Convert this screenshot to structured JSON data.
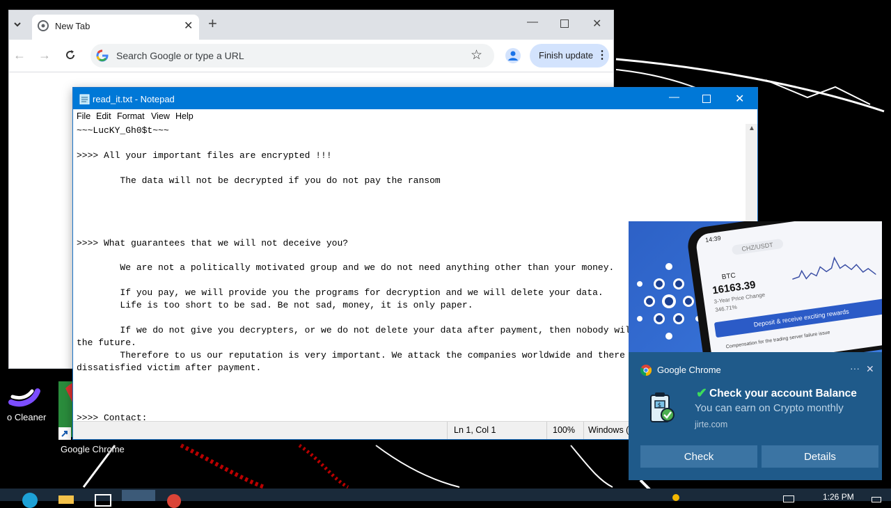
{
  "desktop": {
    "icons": [
      {
        "label": "o Cleaner"
      },
      {
        "label": "Google Chrome"
      }
    ]
  },
  "chrome": {
    "tab_title": "New Tab",
    "omnibox_placeholder": "Search Google or type a URL",
    "finish_update": "Finish update"
  },
  "notepad": {
    "title": "read_it.txt - Notepad",
    "menu": [
      "File",
      "Edit",
      "Format",
      "View",
      "Help"
    ],
    "content": "~~~LucKY_Gh0$t~~~\n\n>>>> All your important files are encrypted !!!\n\n        The data will not be decrypted if you do not pay the ransom\n\n\n\n\n>>>> What guarantees that we will not deceive you?\n\n        We are not a politically motivated group and we do not need anything other than your money.\n\n        If you pay, we will provide you the programs for decryption and we will delete your data.\n        Life is too short to be sad. Be not sad, money, it is only paper.\n\n        If we do not give you decrypters, or we do not delete your data after payment, then nobody will pay us in\nthe future.\n        Therefore to us our reputation is very important. We attack the companies worldwide and there is no\ndissatisfied victim after payment.\n\n\n\n>>>> Contact:",
    "status": {
      "position": "Ln 1, Col 1",
      "zoom": "100%",
      "line_ending": "Windows (CRLF)"
    }
  },
  "toast_image": {
    "phone_time": "14:39",
    "pair": "CHZ/USDT",
    "coin": "BTC",
    "price": "16163.39",
    "change_label": "3-Year Price Change",
    "change_value": "346.71%",
    "banner": "Deposit & receive exciting rewards",
    "compensation": "Compensation for the trading server failure issue"
  },
  "toast": {
    "app": "Google Chrome",
    "title": "Check your account Balance",
    "body": "You can earn on Crypto monthly",
    "source": "jirte.com",
    "buttons": [
      "Check",
      "Details"
    ]
  },
  "taskbar": {
    "time": "1:26 PM"
  }
}
